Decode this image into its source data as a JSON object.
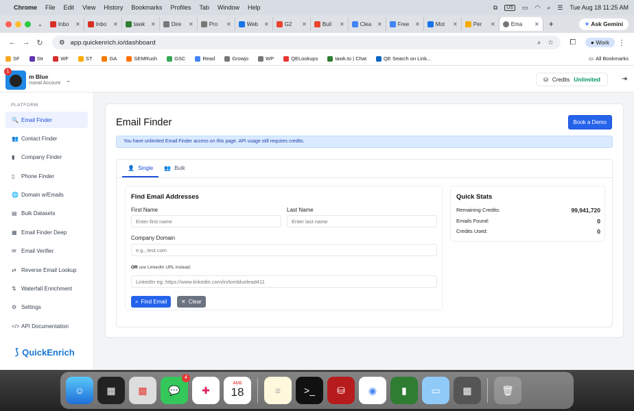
{
  "menubar": {
    "app": "Chrome",
    "items": [
      "File",
      "Edit",
      "View",
      "History",
      "Bookmarks",
      "Profiles",
      "Tab",
      "Window",
      "Help"
    ],
    "input_source": "US",
    "datetime": "Tue Aug 18  11:25 AM"
  },
  "browser": {
    "tabs": [
      {
        "label": "Inbo",
        "color": "#d93025"
      },
      {
        "label": "Inbo",
        "color": "#d93025"
      },
      {
        "label": "tawk",
        "color": "#2e7d32"
      },
      {
        "label": "Dire",
        "color": "#777777"
      },
      {
        "label": "Pro",
        "color": "#777777"
      },
      {
        "label": "Web",
        "color": "#1a73e8"
      },
      {
        "label": "G2",
        "color": "#e8452c"
      },
      {
        "label": "Buil",
        "color": "#e8452c"
      },
      {
        "label": "Clea",
        "color": "#4285f4"
      },
      {
        "label": "Free",
        "color": "#4285f4"
      },
      {
        "label": "Mot",
        "color": "#1a73e8"
      },
      {
        "label": "Per",
        "color": "#f9ab00"
      }
    ],
    "active_tab": "Ema",
    "ask_gemini": "Ask Gemini",
    "url": "app.quickenrich.io/dashboard",
    "profile": "Work",
    "bookmarks": [
      {
        "label": "SF",
        "color": "#f9a825"
      },
      {
        "label": "Str",
        "color": "#5e35b1"
      },
      {
        "label": "WF",
        "color": "#d32f2f"
      },
      {
        "label": "ST",
        "color": "#f9ab00"
      },
      {
        "label": "GA",
        "color": "#f57c00"
      },
      {
        "label": "SEMRush",
        "color": "#ff6f00"
      },
      {
        "label": "GSC",
        "color": "#34a853"
      },
      {
        "label": "Read",
        "color": "#4285f4"
      },
      {
        "label": "Growjo",
        "color": "#777777"
      },
      {
        "label": "WP",
        "color": "#777777"
      },
      {
        "label": "QELookups",
        "color": "#e53935"
      },
      {
        "label": "tawk.to | Chat",
        "color": "#2e7d32"
      },
      {
        "label": "QE Search on Link...",
        "color": "#0a66c2"
      }
    ],
    "all_bookmarks": "All Bookmarks"
  },
  "header": {
    "user_name": "m Blue",
    "account_type": "rsonal Account",
    "chat_badge": "1",
    "credits_label": "Credits",
    "credits_value": "Unlimited"
  },
  "sidebar": {
    "platform_label": "PLATFORM",
    "items": [
      {
        "label": "Email Finder",
        "icon": "🔍"
      },
      {
        "label": "Contact Finder",
        "icon": "👥"
      },
      {
        "label": "Company Finder",
        "icon": "▮"
      },
      {
        "label": "Phone Finder",
        "icon": "▯"
      },
      {
        "label": "Domain w/Emails",
        "icon": "🌐"
      },
      {
        "label": "Bulk Datasets",
        "icon": "▤"
      },
      {
        "label": "Email Finder Deep",
        "icon": "▦"
      },
      {
        "label": "Email Verifier",
        "icon": "✉"
      },
      {
        "label": "Reverse Email Lookup",
        "icon": "⇄"
      },
      {
        "label": "Waterfall Enrichment",
        "icon": "⇅"
      },
      {
        "label": "Settings",
        "icon": "⚙"
      },
      {
        "label": "API Documentation",
        "icon": "</>"
      }
    ],
    "brand": "QuickEnrich"
  },
  "main": {
    "title": "Email Finder",
    "book_demo": "Book a Demo",
    "alert": "You have unlimited Email Finder access on this page. API usage still requires credits.",
    "tabs": [
      "Single",
      "Bulk"
    ],
    "form": {
      "heading": "Find Email Addresses",
      "first_name_label": "First Name",
      "first_name_placeholder": "Enter first name",
      "last_name_label": "Last Name",
      "last_name_placeholder": "Enter last name",
      "domain_label": "Company Domain",
      "domain_placeholder": "e.g., test.com",
      "or_bold": "OR",
      "or_text": " use LinkedIn URL instead:",
      "linkedin_placeholder": "LinkedIn eg: https://www.linkedin.com/in/tombluelead411",
      "find_button": "Find Email",
      "clear_button": "Clear"
    },
    "stats": {
      "heading": "Quick Stats",
      "rows": [
        {
          "label": "Remaining Credits:",
          "value": "99,941,720"
        },
        {
          "label": "Emails Found:",
          "value": "0"
        },
        {
          "label": "Credits Used:",
          "value": "0"
        }
      ]
    }
  },
  "dock": {
    "messages_badge": "4",
    "calendar_month": "AUG",
    "calendar_day": "18"
  }
}
